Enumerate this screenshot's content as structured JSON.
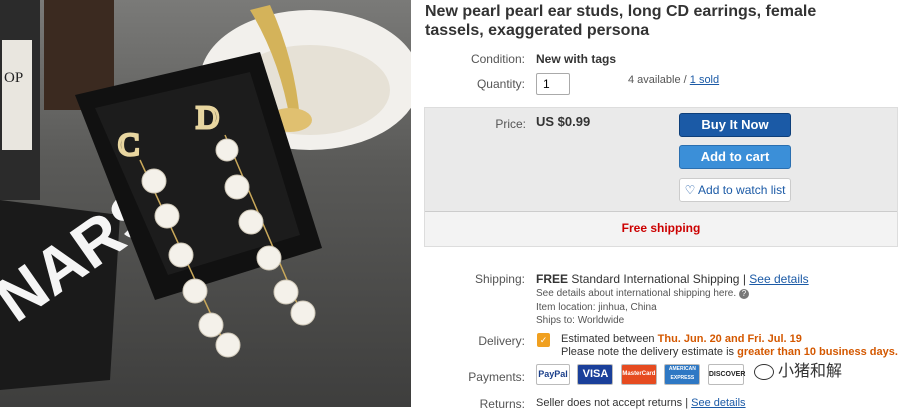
{
  "listing": {
    "title": "New pearl pearl ear studs, long CD earrings, female tassels, exaggerated persona"
  },
  "photo": {
    "box_text": "NARS",
    "bottle_text": "OP",
    "letter_left": "C",
    "letter_right": "D"
  },
  "condition": {
    "label": "Condition:",
    "value": "New with tags"
  },
  "quantity": {
    "label": "Quantity:",
    "value": "1",
    "available": "4 available / ",
    "sold": "1 sold"
  },
  "price": {
    "label": "Price:",
    "value": "US $0.99"
  },
  "buttons": {
    "buy_now": "Buy It Now",
    "add_to_cart": "Add to cart",
    "watch": "Add to watch list"
  },
  "free_shipping": "Free shipping",
  "shipping": {
    "label": "Shipping:",
    "free": "FREE",
    "method": "Standard International Shipping |",
    "details_link": "See details",
    "intl_note": "See details about international shipping here.",
    "item_location": "Item location: jinhua, China",
    "ships_to": "Ships to: Worldwide"
  },
  "delivery": {
    "label": "Delivery:",
    "estimated_prefix": "Estimated between ",
    "dates": "Thu. Jun. 20 and Fri. Jul. 19",
    "note_prefix": "Please note the delivery estimate is ",
    "note_highlight": "greater than 10 business days."
  },
  "payments": {
    "label": "Payments:",
    "methods": [
      "PayPal",
      "VISA",
      "MasterCard",
      "AMERICAN EXPRESS",
      "DISCOVER"
    ]
  },
  "returns": {
    "label": "Returns:",
    "value": "Seller does not accept returns |",
    "link": "See details"
  },
  "watermark": {
    "text": "小猪和解"
  },
  "colors": {
    "buy": "#1b5aa6",
    "cart": "#3b8fd8",
    "free": "#cc0000",
    "orange": "#d45800"
  }
}
